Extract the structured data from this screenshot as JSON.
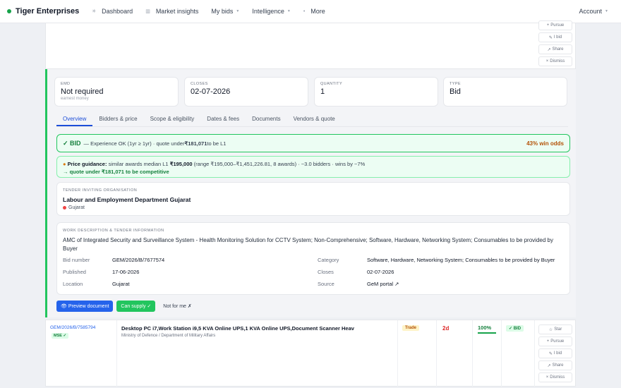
{
  "nav": {
    "brand": "Tiger Enterprises",
    "items": [
      {
        "label": "Dashboard",
        "icon": "grid-icon"
      },
      {
        "label": "Market insights",
        "icon": "chart-icon"
      },
      {
        "label": "My bids",
        "dropdown": true
      },
      {
        "label": "Intelligence",
        "dropdown": true
      },
      {
        "label": "More",
        "icon": "dot-icon"
      }
    ],
    "account": "Account"
  },
  "top_actions": [
    "Pursue",
    "I bid",
    "Share",
    "Dismiss"
  ],
  "stats": [
    {
      "label": "EMD",
      "value": "Not required",
      "sub": "earnest money"
    },
    {
      "label": "Closes",
      "value": "02-07-2026",
      "sub": ""
    },
    {
      "label": "Quantity",
      "value": "1",
      "sub": ""
    },
    {
      "label": "Type",
      "value": "Bid",
      "sub": ""
    }
  ],
  "tabs": [
    "Overview",
    "Bidders & price",
    "Scope & eligibility",
    "Dates & fees",
    "Documents",
    "Vendors & quote"
  ],
  "active_tab": "Overview",
  "verdict": {
    "tag": "✓ BID",
    "text_pre": "— Experience OK (1yr ≥ 1yr) · quote under ",
    "amount": "₹181,071",
    "text_post": " to be L1",
    "odds": "43% win odds"
  },
  "guidance": {
    "label": "Price guidance:",
    "text1": " similar awards median L1 ",
    "median": "₹195,000",
    "text2": " (range ₹195,000–₹1,451,226.81, 8 awards) · ~3.0 bidders · wins by ~7%",
    "cta": "→ quote under ₹181,071 to be competitive"
  },
  "org": {
    "label": "Tender inviting organisation",
    "name": "Labour and Employment Department Gujarat",
    "location": "Gujarat"
  },
  "work": {
    "label": "Work description & tender information",
    "description": "AMC of Integrated Security and Surveillance System - Health Monitoring Solution for CCTV System; Non-Comprehensive; Software, Hardware, Networking System; Consumables to be provided by Buyer",
    "fields_left": [
      {
        "k": "Bid number",
        "v": "GEM/2026/B/7677574"
      },
      {
        "k": "Published",
        "v": "17-06-2026"
      },
      {
        "k": "Location",
        "v": "Gujarat"
      }
    ],
    "fields_right": [
      {
        "k": "Category",
        "v": "Software, Hardware, Networking System; Consumables to be provided by Buyer"
      },
      {
        "k": "Closes",
        "v": "02-07-2026"
      },
      {
        "k": "Source",
        "v": "GeM portal ↗"
      }
    ]
  },
  "buttons": {
    "preview": "👁 Preview document",
    "can_supply": "Can supply ✓",
    "not_for_me": "Not for me ✗"
  },
  "row": {
    "id": "GEM/2026/B/7585794",
    "mse": "MSE ✓",
    "title": "Desktop PC i7,Work Station i9,5 KVA Online UPS,1 KVA Online UPS,Document Scanner Heav",
    "subtitle": "Ministry of Defence / Department of Military Affairs",
    "type": "Trade",
    "days": "2d",
    "match": "100%",
    "match_fraction": 1.0,
    "verdict": "✓ BID",
    "actions": [
      "Star",
      "Pursue",
      "I bid",
      "Share",
      "Dismiss"
    ]
  }
}
